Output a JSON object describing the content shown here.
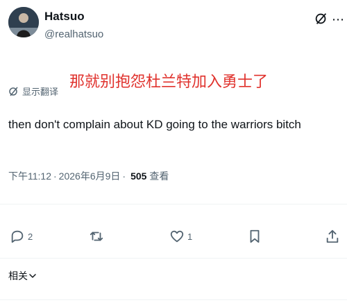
{
  "author": {
    "display_name": "Hatsuo",
    "handle": "@realhatsuo"
  },
  "translate": {
    "label": "显示翻译"
  },
  "overlay_caption": "那就别抱怨杜兰特加入勇士了",
  "tweet": {
    "text": "then don't complain about KD going to the warriors bitch"
  },
  "meta": {
    "time": "下午11:12",
    "separator_1": "·",
    "date": "2026年6月9日",
    "separator_2": "·",
    "views_count": "505",
    "views_label": "查看"
  },
  "actions": {
    "reply_count": "2",
    "retweet_count": "",
    "like_count": "1"
  },
  "related": {
    "label": "相关"
  },
  "icons": {
    "grok": "grok-icon",
    "more": "more-icon",
    "translate": "translate-icon",
    "reply": "reply-icon",
    "retweet": "retweet-icon",
    "like": "heart-icon",
    "bookmark": "bookmark-icon",
    "share": "share-icon",
    "chevron": "chevron-down-icon"
  },
  "colors": {
    "text_primary": "#0f1419",
    "text_secondary": "#536471",
    "overlay_red": "#e0322d",
    "divider": "#eff3f4"
  }
}
